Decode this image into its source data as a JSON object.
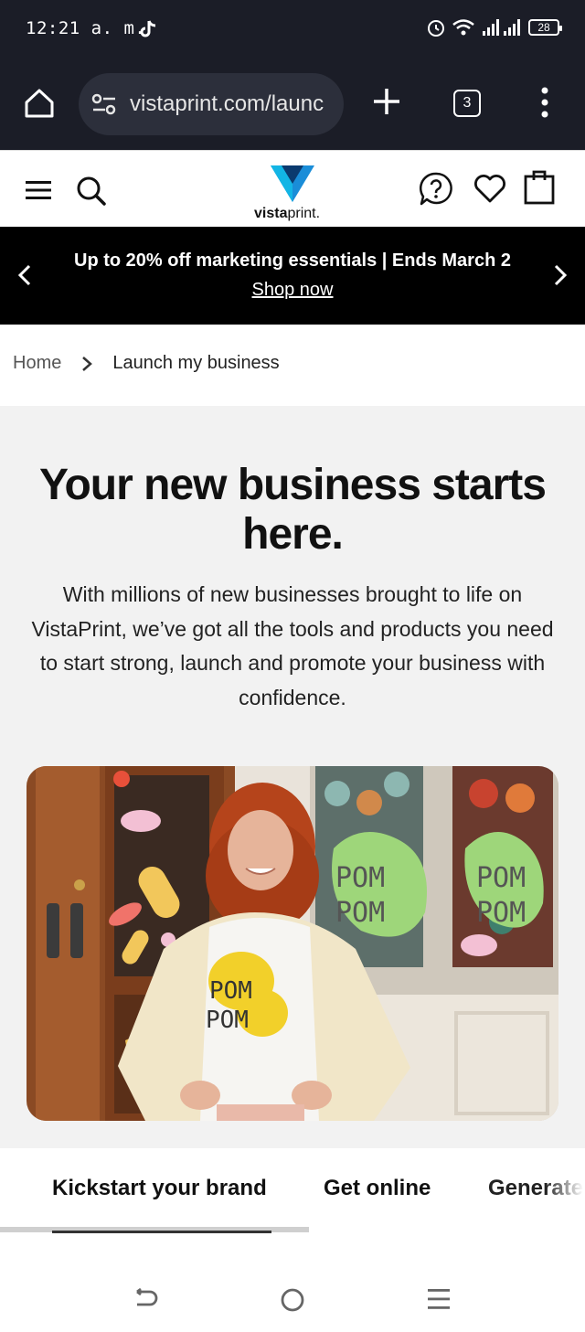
{
  "status_bar": {
    "time": "12:21 a. m.",
    "battery": "28",
    "icons": [
      "tiktok-icon",
      "alarm-icon",
      "wifi-icon",
      "signal-icon",
      "battery-icon"
    ]
  },
  "browser": {
    "url": "vistaprint.com/launc",
    "tab_count": "3",
    "icons": [
      "home-icon",
      "site-settings-icon",
      "new-tab-icon",
      "tab-switcher-icon",
      "more-menu-icon"
    ]
  },
  "site_header": {
    "logo_bold": "vista",
    "logo_light": "print",
    "logo_suffix": ".",
    "brand_color": "#1a8dd8",
    "icons": [
      "menu-icon",
      "search-icon",
      "help-icon",
      "heart-icon",
      "cart-icon"
    ]
  },
  "promo": {
    "text": "Up to 20% off marketing essentials | Ends March 2",
    "link": "Shop now"
  },
  "breadcrumb": {
    "home": "Home",
    "current": "Launch my business"
  },
  "hero": {
    "title": "Your new business starts here.",
    "body": "With millions of new businesses brought to life on VistaPrint, we’ve got all the tools and products you need to start strong, launch and promote your business with confidence.",
    "shirt_text_1": "POM",
    "shirt_text_2": "POM",
    "window_text_1": "POM",
    "window_text_2": "POM"
  },
  "tabs": {
    "items": [
      "Kickstart your brand",
      "Get online",
      "Generate"
    ],
    "active": "Kickstart your brand"
  },
  "system_nav": {
    "icons": [
      "back-icon",
      "home-circle-icon",
      "recents-icon"
    ]
  }
}
